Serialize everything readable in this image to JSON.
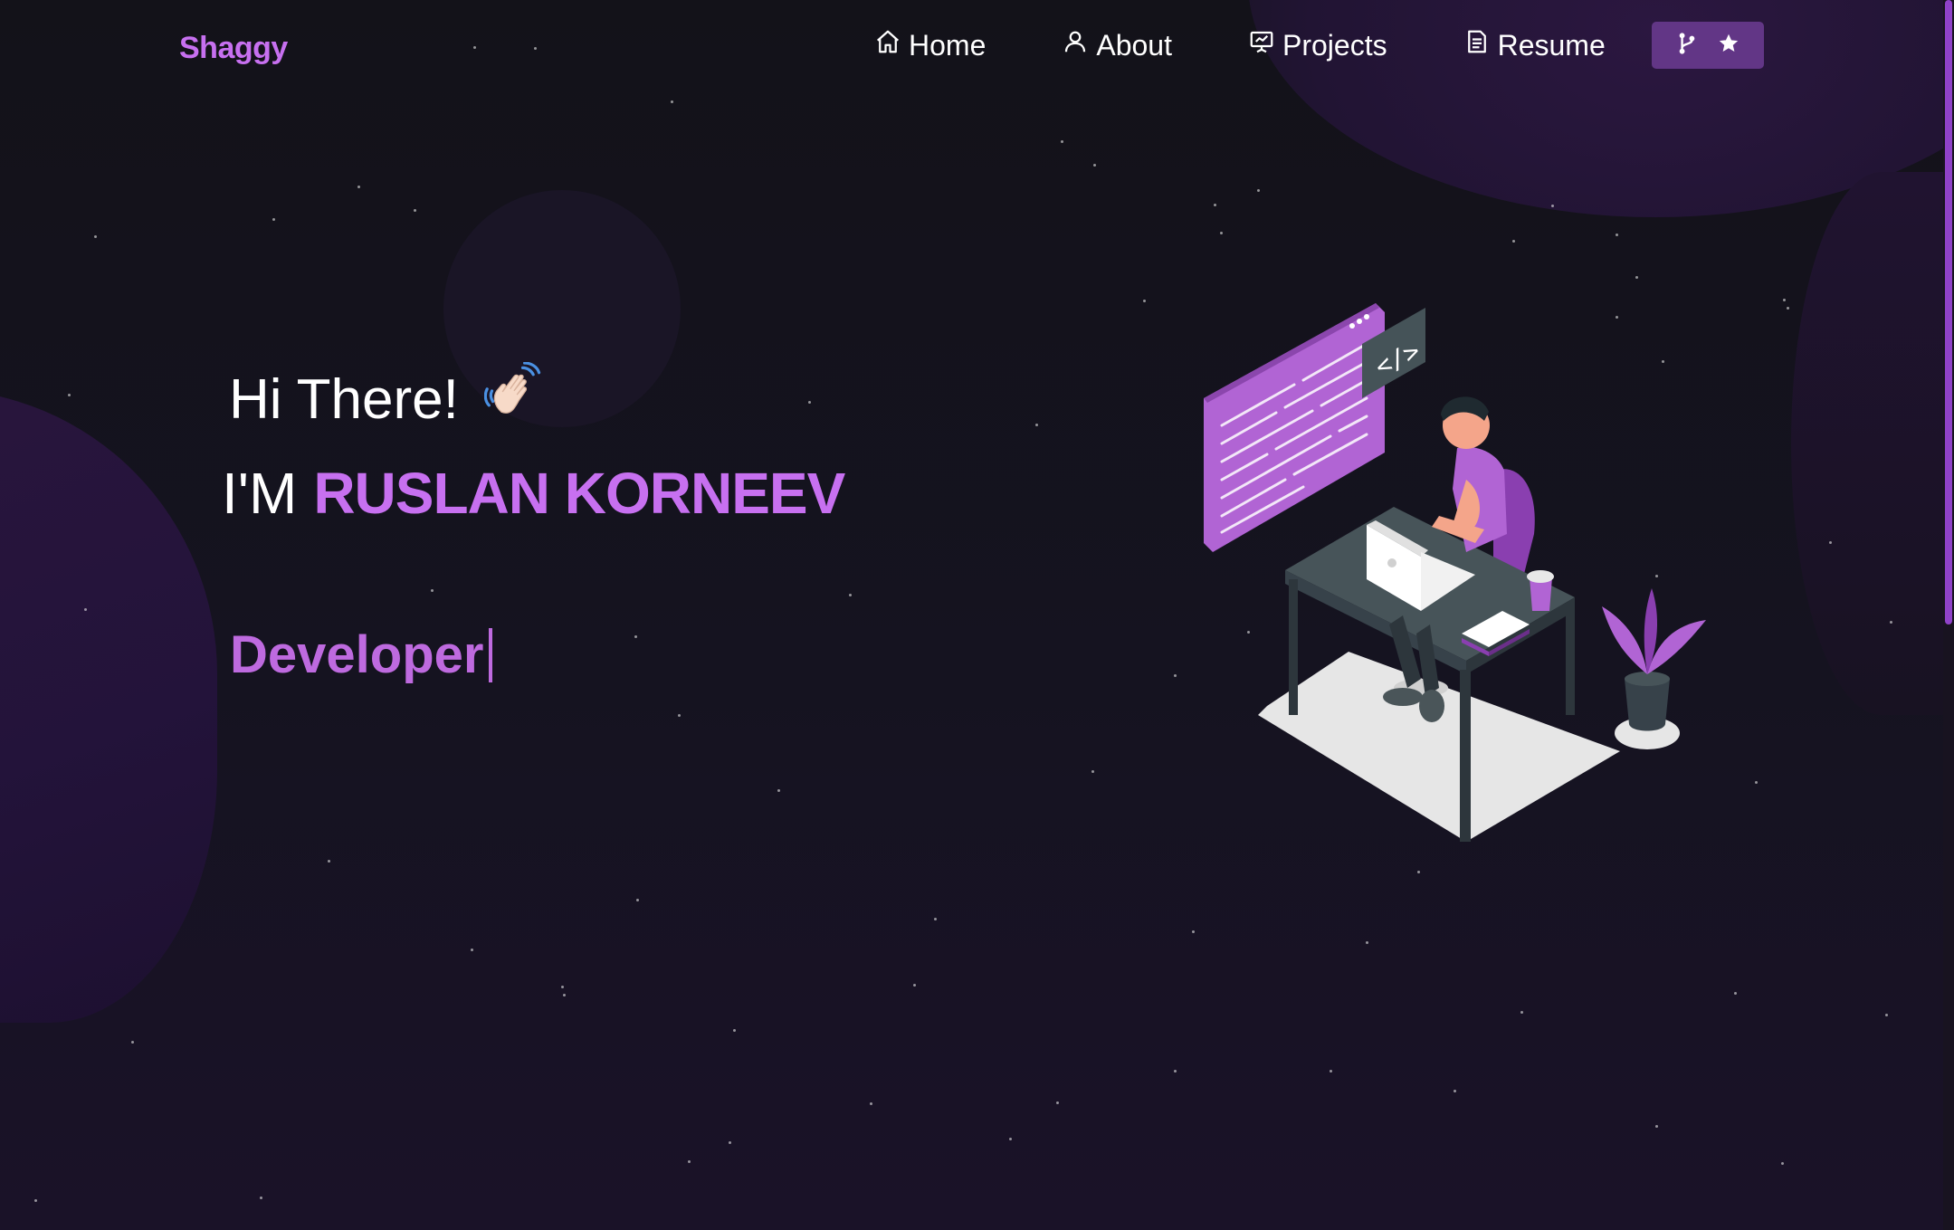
{
  "brand": {
    "name": "Shaggy"
  },
  "nav": {
    "items": [
      {
        "label": "Home",
        "icon": "home-icon"
      },
      {
        "label": "About",
        "icon": "user-icon"
      },
      {
        "label": "Projects",
        "icon": "projects-icon"
      },
      {
        "label": "Resume",
        "icon": "document-icon"
      }
    ],
    "fork_button": {
      "icons": [
        "git-fork-icon",
        "star-icon"
      ]
    }
  },
  "hero": {
    "greeting": "Hi There!",
    "greeting_emoji": "waving-hand",
    "name_prefix": "I'M",
    "name": "RUSLAN KORNEEV",
    "typed_role": "Developer",
    "illustration_code_tag": "</>"
  },
  "colors": {
    "background": "#14121c",
    "accent": "#c770f0",
    "button": "#623686",
    "scrollbar": "#8f42c8"
  }
}
